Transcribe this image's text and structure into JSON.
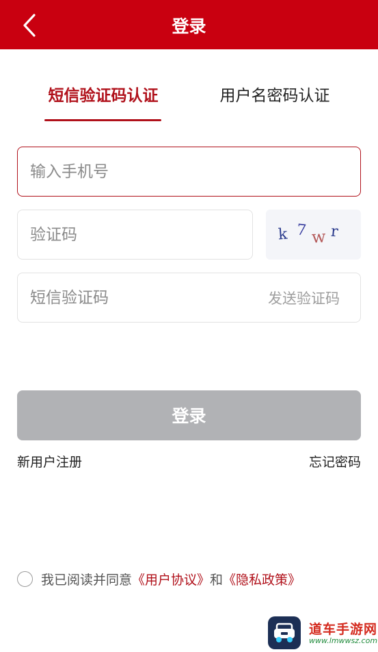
{
  "header": {
    "title": "登录",
    "back_icon": "chevron-left-icon"
  },
  "tabs": [
    {
      "label": "短信验证码认证",
      "active": true
    },
    {
      "label": "用户名密码认证",
      "active": false
    }
  ],
  "form": {
    "phone_placeholder": "输入手机号",
    "captcha_placeholder": "验证码",
    "captcha_chars": [
      "k",
      "7",
      "w",
      "r"
    ],
    "sms_placeholder": "短信验证码",
    "send_code_label": "发送验证码"
  },
  "login_button": "登录",
  "links": {
    "register": "新用户注册",
    "forgot": "忘记密码"
  },
  "agreement": {
    "prefix": "我已阅读并同意",
    "user_agreement": "《用户协议》",
    "and": "和",
    "privacy_policy": "《隐私政策》"
  },
  "watermark": {
    "name": "道车手游网",
    "url": "www.lmwwsz.com"
  },
  "colors": {
    "brand_red": "#c90010",
    "accent_red": "#b0101a",
    "disabled_button": "#b1b2b5"
  }
}
